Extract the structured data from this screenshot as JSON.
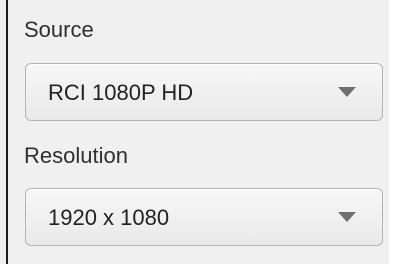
{
  "source": {
    "label": "Source",
    "value": "RCI 1080P HD"
  },
  "resolution": {
    "label": "Resolution",
    "value": "1920 x 1080"
  },
  "icons": {
    "dropdown": "chevron-down-icon"
  }
}
